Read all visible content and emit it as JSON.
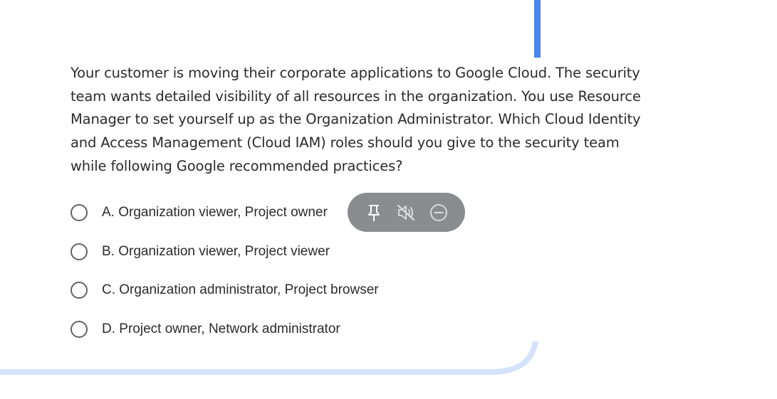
{
  "question": {
    "text": "Your customer is moving their corporate applications to Google Cloud. The security team wants detailed visibility of all resources in the organization. You use Resource Manager to set yourself up as the Organization Administrator. Which Cloud Identity and Access Management (Cloud IAM) roles should you give to the security team while following Google recommended practices?"
  },
  "options": [
    {
      "label": "A. Organization viewer, Project owner",
      "selected": false
    },
    {
      "label": "B. Organization viewer, Project viewer",
      "selected": false
    },
    {
      "label": "C. Organization administrator, Project browser",
      "selected": false
    },
    {
      "label": "D. Project owner, Network administrator",
      "selected": false
    }
  ],
  "overlay_toolbar": {
    "buttons": [
      {
        "icon": "pin-icon"
      },
      {
        "icon": "mute-icon"
      },
      {
        "icon": "remove-icon"
      }
    ]
  },
  "colors": {
    "accent_blue": "#4a85f0",
    "light_blue_curve": "#d4e3fb",
    "toolbar_bg": "#8a8c8f",
    "text": "#2b2b2b"
  }
}
